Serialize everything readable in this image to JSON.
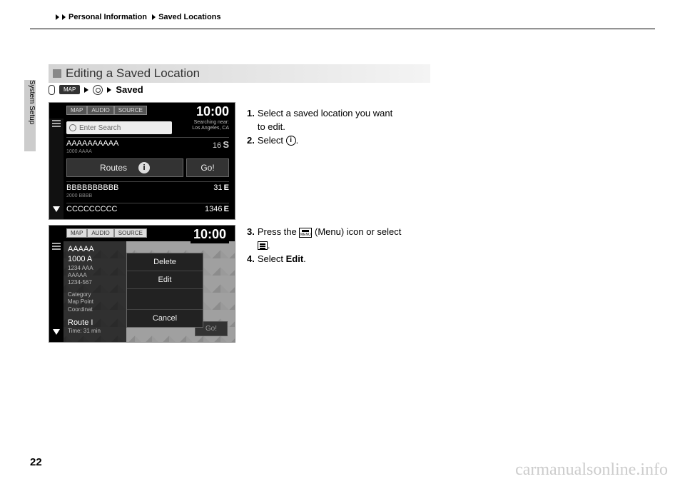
{
  "breadcrumb": {
    "a": "Personal Information",
    "b": "Saved Locations"
  },
  "side_tab": "System Setup",
  "heading": "Editing a Saved Location",
  "crumb": {
    "map": "MAP",
    "saved": "Saved"
  },
  "s1": {
    "pills": {
      "map": "MAP",
      "audio": "AUDIO",
      "source": "SOURCE"
    },
    "clock": "10:00",
    "search_placeholder": "Enter Search",
    "near_line1": "Searching near:",
    "near_line2": "Los Angeles, CA",
    "rowA": {
      "title": "AAAAAAAAAA",
      "sub": "1000 AAAA",
      "dist": "16",
      "unit": "S"
    },
    "routes": "Routes",
    "go": "Go!",
    "rowB": {
      "title": "BBBBBBBBBB",
      "sub": "2000 BBBB",
      "dist": "31",
      "unit": "E"
    },
    "rowC": {
      "title": "CCCCCCCCC",
      "dist": "1346",
      "unit": "E"
    }
  },
  "s2": {
    "pills": {
      "map": "MAP",
      "audio": "AUDIO",
      "source": "SOURCE"
    },
    "clock": "10:00",
    "left": {
      "l1": "AAAAA",
      "l2": "1000 A",
      "l3": "1234 AAA",
      "l4": "AAAAA",
      "l5": "1234-567",
      "cat": "Category",
      "mp": "Map Point",
      "co": "Coordinat",
      "ri": "Route I",
      "time": "Time: 31 min"
    },
    "popup": {
      "delete": "Delete",
      "edit": "Edit",
      "cancel": "Cancel"
    },
    "go": "Go!"
  },
  "steps1": {
    "s1_num": "1.",
    "s1_a": "Select a saved location you want",
    "s1_b": "to edit.",
    "s2_num": "2.",
    "s2_a": "Select ",
    "s2_b": "."
  },
  "steps2": {
    "s3_num": "3.",
    "s3_a": "Press the ",
    "s3_b": " (Menu) icon or select",
    "s3_c": ".",
    "s4_num": "4.",
    "s4_a": "Select ",
    "s4_b": "Edit",
    "s4_c": "."
  },
  "page_number": "22",
  "watermark": "carmanualsonline.info"
}
